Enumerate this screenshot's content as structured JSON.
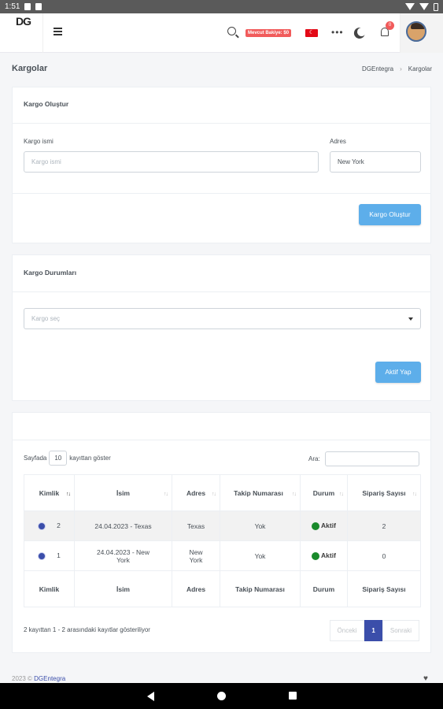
{
  "status_bar": {
    "time": "1:51"
  },
  "header": {
    "logo": "DG",
    "balance": "Mevcut Bakiye: $0",
    "notification_count": "0"
  },
  "page": {
    "title": "Kargolar",
    "breadcrumb": [
      "DGEntegra",
      "Kargolar"
    ]
  },
  "create_card": {
    "title": "Kargo Oluştur",
    "name_label": "Kargo ismi",
    "name_placeholder": "Kargo ismi",
    "address_label": "Adres",
    "address_value": "New York",
    "submit": "Kargo Oluştur"
  },
  "status_card": {
    "title": "Kargo Durumları",
    "select_placeholder": "Kargo seç",
    "submit": "Aktif Yap"
  },
  "table_card": {
    "length_prefix": "Sayfada",
    "length_value": "10",
    "length_suffix": "kayıttan göster",
    "search_label": "Ara:",
    "columns": [
      "Kimlik",
      "İsim",
      "Adres",
      "Takip Numarası",
      "Durum",
      "Sipariş Sayısı"
    ],
    "rows": [
      {
        "id": "2",
        "name": "24.04.2023 - Texas",
        "address": "Texas",
        "tracking": "Yok",
        "status": "Aktif",
        "orders": "2"
      },
      {
        "id": "1",
        "name": "24.04.2023 - New York",
        "address": "New York",
        "tracking": "Yok",
        "status": "Aktif",
        "orders": "0"
      }
    ],
    "info": "2 kayıttan 1 - 2 arasındaki kayıtlar gösteriliyor",
    "pagination": {
      "prev": "Önceki",
      "current": "1",
      "next": "Sonraki"
    }
  },
  "footer": {
    "year": "2023 ©",
    "brand": "DGEntegra"
  },
  "colors": {
    "primary": "#3b4eaa",
    "button": "#5daeea",
    "active": "#198a2b",
    "danger": "#f15b5b"
  }
}
